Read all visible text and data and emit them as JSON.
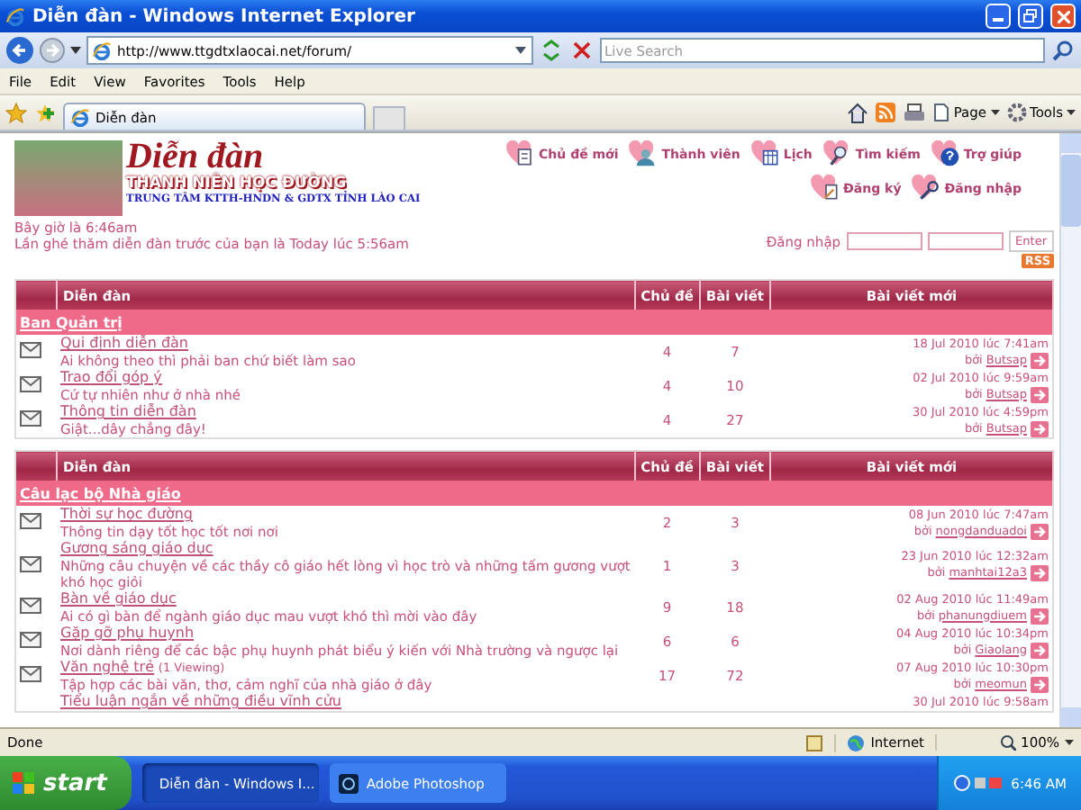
{
  "window": {
    "title": "Diễn đàn - Windows Internet Explorer"
  },
  "address_bar": {
    "url": "http://www.ttgdtxlaocai.net/forum/"
  },
  "search": {
    "placeholder": "Live Search"
  },
  "menu": [
    "File",
    "Edit",
    "View",
    "Favorites",
    "Tools",
    "Help"
  ],
  "tabs": [
    {
      "label": "Diễn đàn",
      "selected": true
    }
  ],
  "toolbar": [
    "Page",
    "Tools"
  ],
  "site": {
    "title": "Diễn đàn",
    "subtitle": "THANH NIÊN HỌC ĐƯỜNG",
    "org": "TRUNG TÂM KTTH-HNDN & GDTX TỈNH LÀO CAI"
  },
  "nav": [
    [
      "Chủ đề mới",
      "Thành viên",
      "Lịch",
      "Tìm kiếm",
      "Trợ giúp"
    ],
    [
      "Đăng ký",
      "Đăng nhập"
    ]
  ],
  "visit_info": [
    "Bây giờ là 6:46am",
    "Lần ghé thăm diễn đàn trước của bạn là Today lúc 5:56am"
  ],
  "login": {
    "label": "Đăng nhập",
    "button": "Enter"
  },
  "rss": "RSS",
  "sections": [
    {
      "columns": [
        "Diễn đàn",
        "Chủ đề",
        "Bài viết",
        "Bài viết mới"
      ],
      "title": "Ban Quản trị",
      "forums": [
        {
          "name": "Qui định diễn đàn",
          "description": "Ai không theo thì phải ban chứ biết làm sao",
          "topics": "4",
          "posts": "7",
          "last_date": "18 Jul 2010 lúc 7:41am",
          "by": "bởi",
          "user": "Butsap"
        },
        {
          "name": "Trao đổi góp ý",
          "description": "Cứ tự nhiên như ở nhà nhé",
          "topics": "4",
          "posts": "10",
          "last_date": "02 Jul 2010 lúc 9:59am",
          "by": "bởi",
          "user": "Butsap"
        },
        {
          "name": "Thông tin diễn đàn",
          "description": "Giật...dây chẳng đây!",
          "topics": "4",
          "posts": "27",
          "last_date": "30 Jul 2010 lúc 4:59pm",
          "by": "bởi",
          "user": "Butsap"
        }
      ]
    },
    {
      "columns": [
        "Diễn đàn",
        "Chủ đề",
        "Bài viết",
        "Bài viết mới"
      ],
      "title": "Câu lạc bộ Nhà giáo",
      "forums": [
        {
          "name": "Thời sự học đường",
          "description": "Thông tin dạy tốt học tốt nơi nơi",
          "topics": "2",
          "posts": "3",
          "last_date": "08 Jun 2010 lúc 7:47am",
          "by": "bởi",
          "user": "nongdanduadoi"
        },
        {
          "name": "Gương sáng giáo dục",
          "description": "Những câu chuyện về các thầy cô giáo hết lòng vì học trò và những tấm gương vượt khó học giỏi",
          "topics": "1",
          "posts": "3",
          "last_date": "23 Jun 2010 lúc 12:32am",
          "by": "bởi",
          "user": "manhtai12a3"
        },
        {
          "name": "Bàn về giáo dục",
          "description": "Ai có gì bàn để ngành giáo dục mau vượt khó thì mời vào đây",
          "topics": "9",
          "posts": "18",
          "last_date": "02 Aug 2010 lúc 11:49am",
          "by": "bởi",
          "user": "phanungdiuem"
        },
        {
          "name": "Gặp gỡ phụ huynh",
          "description": "Nơi dành riêng để các bậc phụ huynh phát biểu ý kiến với Nhà trường và ngược lại",
          "topics": "6",
          "posts": "6",
          "last_date": "04 Aug 2010 lúc 10:34pm",
          "by": "bởi",
          "user": "Giaolang"
        },
        {
          "name": "Văn nghệ trẻ",
          "viewing": "(1 Viewing)",
          "description": "Tập hợp các bài văn, thơ, cảm nghĩ của nhà giáo ở đây",
          "topics": "17",
          "posts": "72",
          "last_date": "07 Aug 2010 lúc 10:30pm",
          "by": "bởi",
          "user": "meomun"
        },
        {
          "name": "Tiểu luận ngắn về những điều vĩnh cửu",
          "last_date": "30 Jul 2010 lúc 9:58am"
        }
      ]
    }
  ],
  "status_bar": {
    "text": "Done",
    "zone": "Internet",
    "zoom": "100%"
  },
  "taskbar": {
    "start": "start",
    "tasks": [
      {
        "label": "Diễn đàn - Windows I...",
        "selected": true
      },
      {
        "label": "Adobe Photoshop",
        "selected": false
      }
    ],
    "clock": "6:46 AM"
  }
}
